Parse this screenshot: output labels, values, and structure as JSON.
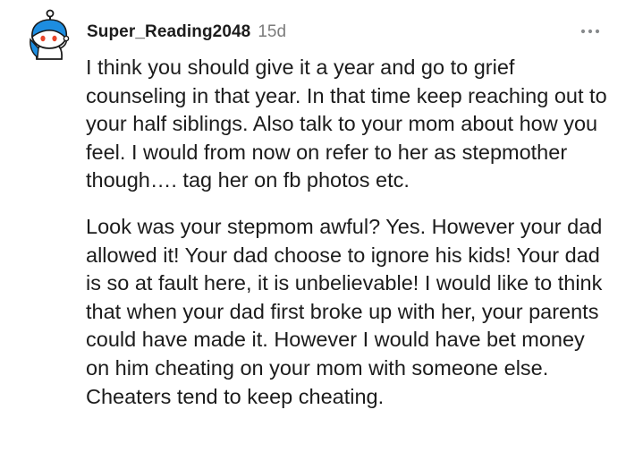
{
  "comment": {
    "author": {
      "username": "Super_Reading2048",
      "avatar_icon": "snoo-avatar-icon"
    },
    "age": "15d",
    "more_icon": "more-options-icon",
    "paragraphs": [
      "I think you should give it a year and go to grief counseling in that year. In that time keep reaching out to your half siblings. Also talk to your mom about how you feel. I would from now on refer to her as stepmother though…. tag her on fb photos etc.",
      "Look was your stepmom awful? Yes. However your dad allowed it! Your dad choose to ignore his kids! Your dad is so at fault here, it is unbelievable! I would like to think that when your dad first broke up with her, your parents could have made it. However I would have bet money on him cheating on your mom with someone else. Cheaters tend to keep cheating."
    ]
  },
  "colors": {
    "text": "#1c1c1c",
    "meta_text": "#7c7c7c",
    "avatar_blue": "#1d8de0",
    "background": "#ffffff"
  }
}
